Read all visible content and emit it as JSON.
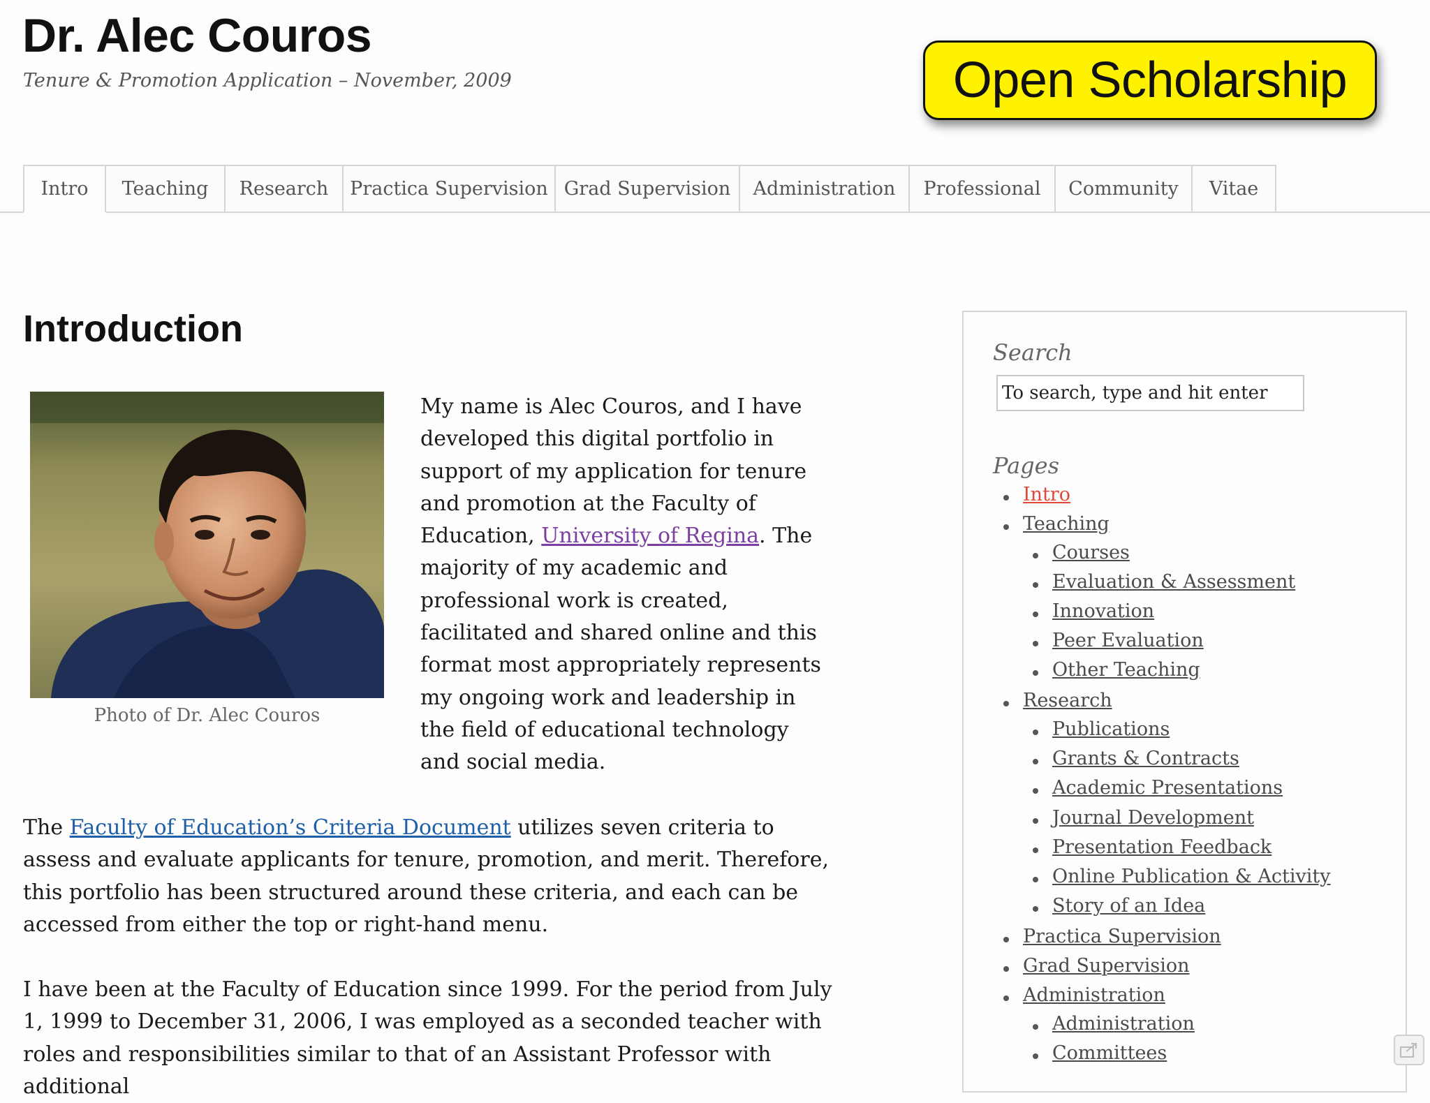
{
  "header": {
    "title": "Dr. Alec Couros",
    "subtitle": "Tenure & Promotion Application – November, 2009"
  },
  "badge": {
    "text": "Open Scholarship",
    "color": "#fff200"
  },
  "nav": {
    "tabs": [
      {
        "label": "Intro"
      },
      {
        "label": "Teaching"
      },
      {
        "label": "Research"
      },
      {
        "label": "Practica Supervision"
      },
      {
        "label": "Grad Supervision"
      },
      {
        "label": "Administration"
      },
      {
        "label": "Professional"
      },
      {
        "label": "Community"
      },
      {
        "label": "Vitae"
      }
    ]
  },
  "main": {
    "heading": "Introduction",
    "photo_caption": "Photo of Dr. Alec Couros",
    "intro": {
      "before_link": "My name is Alec Couros, and I have developed this digital portfolio in support of my application for tenure and promotion at the Faculty of Education, ",
      "link": "University of Regina",
      "after_link": ". The majority of my academic and professional work is created, facilitated and shared online and this format most appropriately represents my ongoing work and leadership in the field of educational technology and social media."
    },
    "para2": {
      "before_link": "The ",
      "link": "Faculty of Education’s Criteria Document",
      "after_link": " utilizes seven criteria to assess and evaluate applicants for tenure, promotion, and merit. Therefore, this portfolio has been structured around these criteria, and each can be accessed from either the top or right-hand menu."
    },
    "para3": "I have been at the Faculty of Education since 1999. For the period from July 1, 1999 to December 31, 2006, I was employed as a seconded teacher with roles and responsibilities similar to that of an Assistant Professor with additional"
  },
  "sidebar": {
    "search_heading": "Search",
    "search_placeholder": "To search, type and hit enter",
    "pages_heading": "Pages",
    "pages": [
      {
        "label": "Intro",
        "level": 1,
        "active": true
      },
      {
        "label": "Teaching",
        "level": 1
      },
      {
        "label": "Courses",
        "level": 2
      },
      {
        "label": "Evaluation & Assessment",
        "level": 2
      },
      {
        "label": "Innovation",
        "level": 2
      },
      {
        "label": "Peer Evaluation",
        "level": 2
      },
      {
        "label": "Other Teaching",
        "level": 2
      },
      {
        "label": "Research",
        "level": 1
      },
      {
        "label": "Publications",
        "level": 2
      },
      {
        "label": "Grants & Contracts",
        "level": 2
      },
      {
        "label": "Academic Presentations",
        "level": 2
      },
      {
        "label": "Journal Development",
        "level": 2
      },
      {
        "label": "Presentation Feedback",
        "level": 2
      },
      {
        "label": "Online Publication & Activity",
        "level": 2
      },
      {
        "label": "Story of an Idea",
        "level": 2
      },
      {
        "label": "Practica Supervision",
        "level": 1
      },
      {
        "label": "Grad Supervision",
        "level": 1
      },
      {
        "label": "Administration",
        "level": 1
      },
      {
        "label": "Administration",
        "level": 2
      },
      {
        "label": "Committees",
        "level": 2
      }
    ]
  },
  "colors": {
    "active_link": "#e0483a",
    "visited_link": "#7b3fa0",
    "link": "#1f5fa8"
  },
  "icons": {
    "corner": "share-icon"
  }
}
